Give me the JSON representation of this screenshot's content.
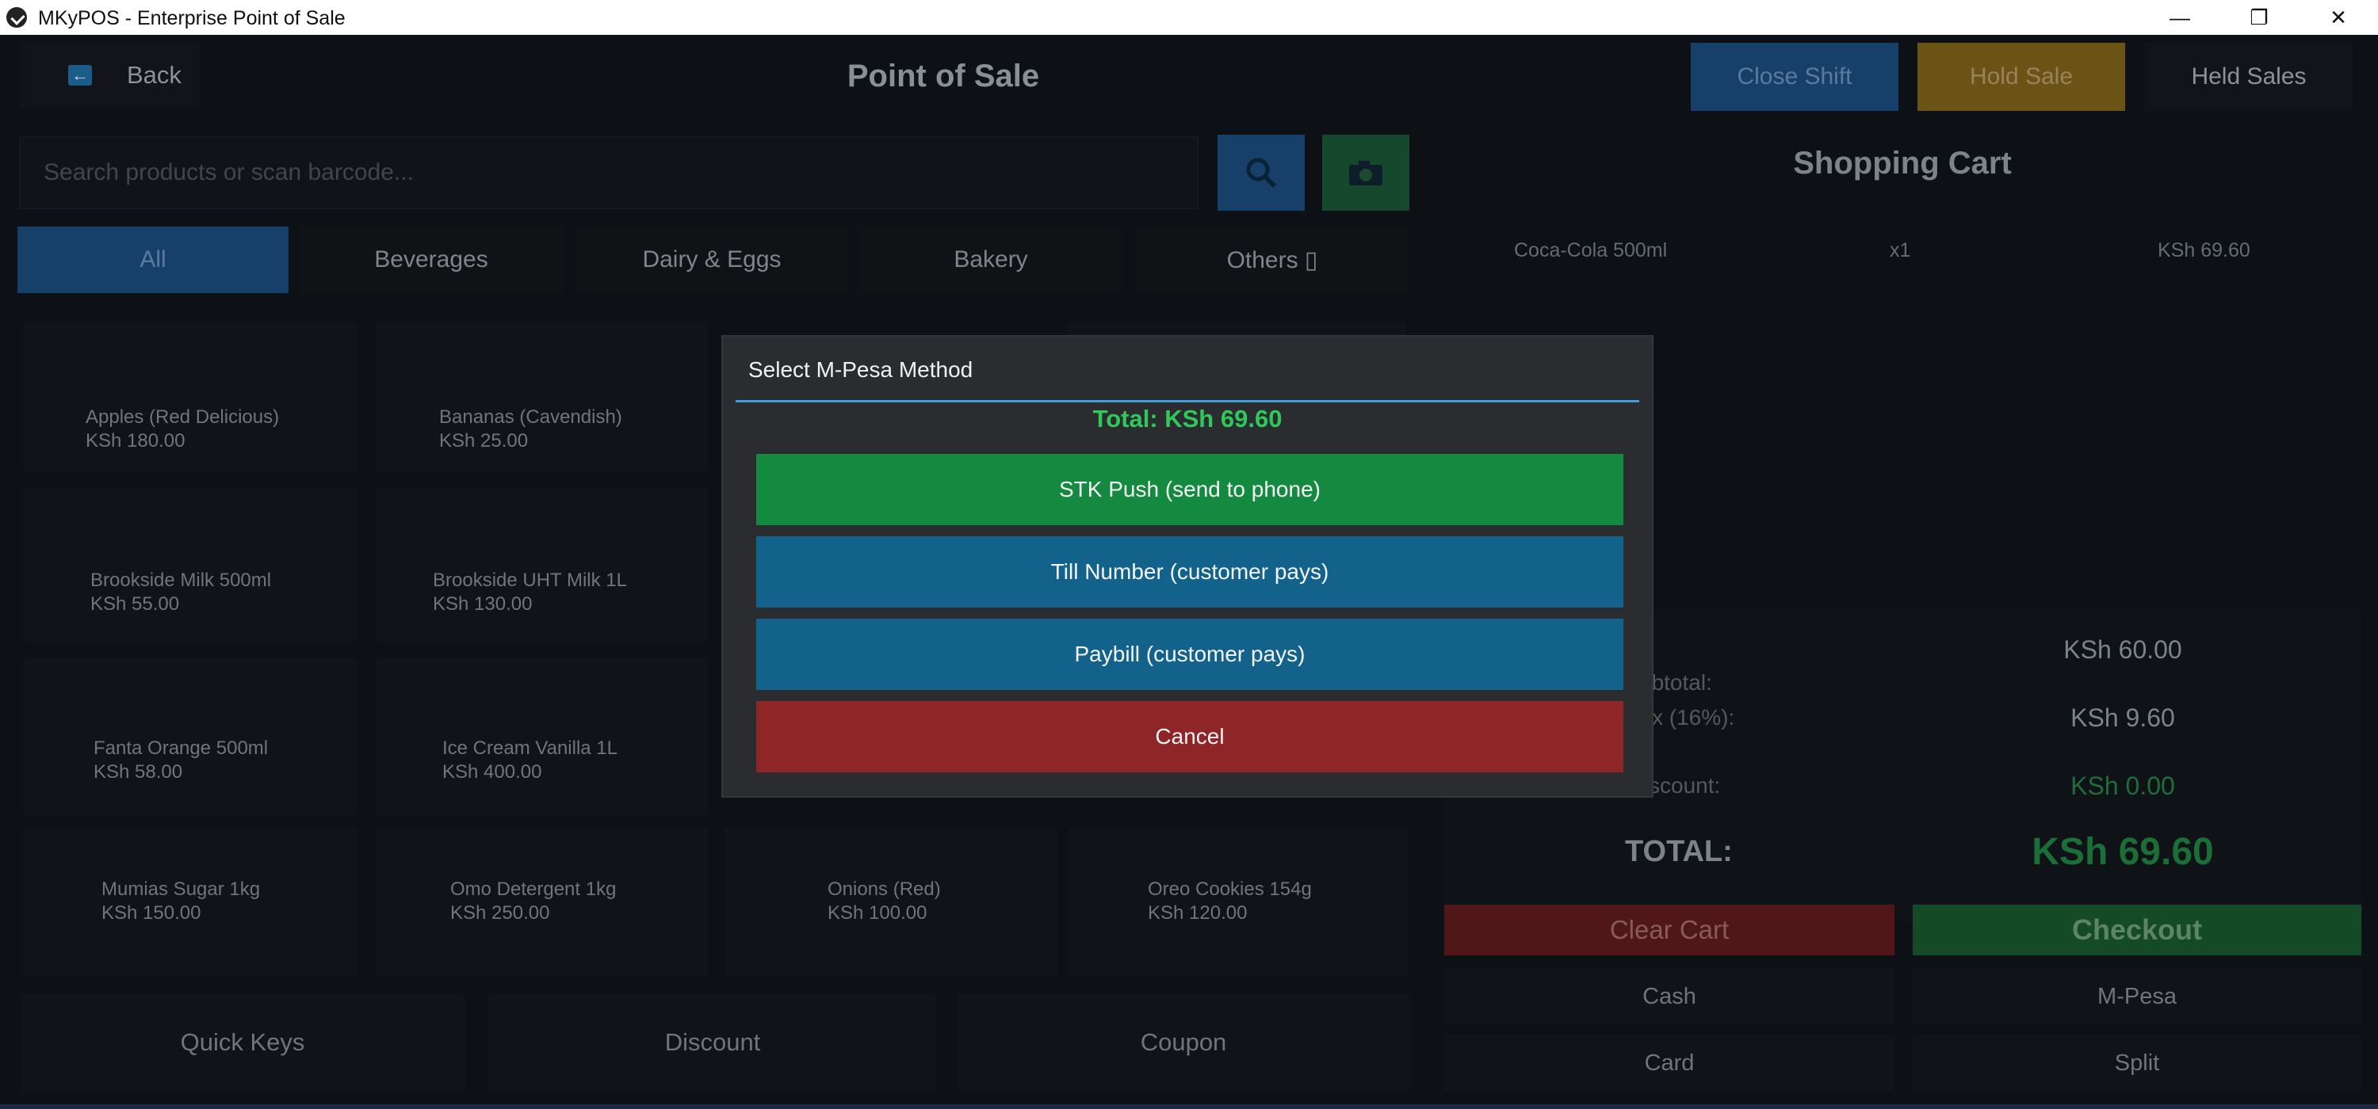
{
  "window": {
    "title": "MKyPOS - Enterprise Point of Sale"
  },
  "header": {
    "back_label": "Back",
    "title": "Point of Sale",
    "close_shift": "Close Shift",
    "hold_sale": "Hold Sale",
    "held_sales": "Held Sales"
  },
  "search": {
    "placeholder": "Search products or scan barcode..."
  },
  "categories": [
    "All",
    "Beverages",
    "Dairy & Eggs",
    "Bakery",
    "Others ▯"
  ],
  "products": [
    {
      "name": "Apples (Red Delicious)",
      "price": "KSh 180.00"
    },
    {
      "name": "Bananas (Cavendish)",
      "price": "KSh 25.00"
    },
    {
      "name": "Brookside Milk 500ml",
      "price": "KSh 55.00"
    },
    {
      "name": "Brookside UHT Milk 1L",
      "price": "KSh 130.00"
    },
    {
      "name": "Fanta Orange 500ml",
      "price": "KSh 58.00"
    },
    {
      "name": "Ice Cream Vanilla 1L",
      "price": "KSh 400.00"
    },
    {
      "name": "Mumias Sugar 1kg",
      "price": "KSh 150.00"
    },
    {
      "name": "Omo Detergent 1kg",
      "price": "KSh 250.00"
    },
    {
      "name": "Onions (Red)",
      "price": "KSh 100.00"
    },
    {
      "name": "Oreo Cookies 154g",
      "price": "KSh 120.00"
    }
  ],
  "quick_actions": [
    "Quick Keys",
    "Discount",
    "Coupon"
  ],
  "cart": {
    "title": "Shopping Cart",
    "items": [
      {
        "name": "Coca-Cola 500ml",
        "qty": "x1",
        "price": "KSh 69.60"
      }
    ],
    "subtotal_label": "ubtotal:",
    "subtotal_value": "KSh 60.00",
    "tax_label": "x (16%):",
    "tax_value": "KSh 9.60",
    "discount_label": "scount:",
    "discount_value": "KSh 0.00",
    "total_label": "TOTAL:",
    "total_value": "KSh 69.60",
    "clear_cart": "Clear Cart",
    "checkout": "Checkout",
    "payment_methods": [
      "Cash",
      "M-Pesa",
      "Card",
      "Split"
    ]
  },
  "modal": {
    "title": "Select M-Pesa Method",
    "total_text": "Total:  KSh 69.60",
    "stk_push": "STK Push  (send to phone)",
    "till_number": "Till Number  (customer pays)",
    "paybill": "Paybill  (customer pays)",
    "cancel": "Cancel"
  },
  "colors": {
    "stk_green": "#138a40",
    "till_blue": "#12628c",
    "cancel_red": "#8e2527",
    "total_green": "#2ec95a",
    "divider_blue": "#3ea0d8"
  }
}
